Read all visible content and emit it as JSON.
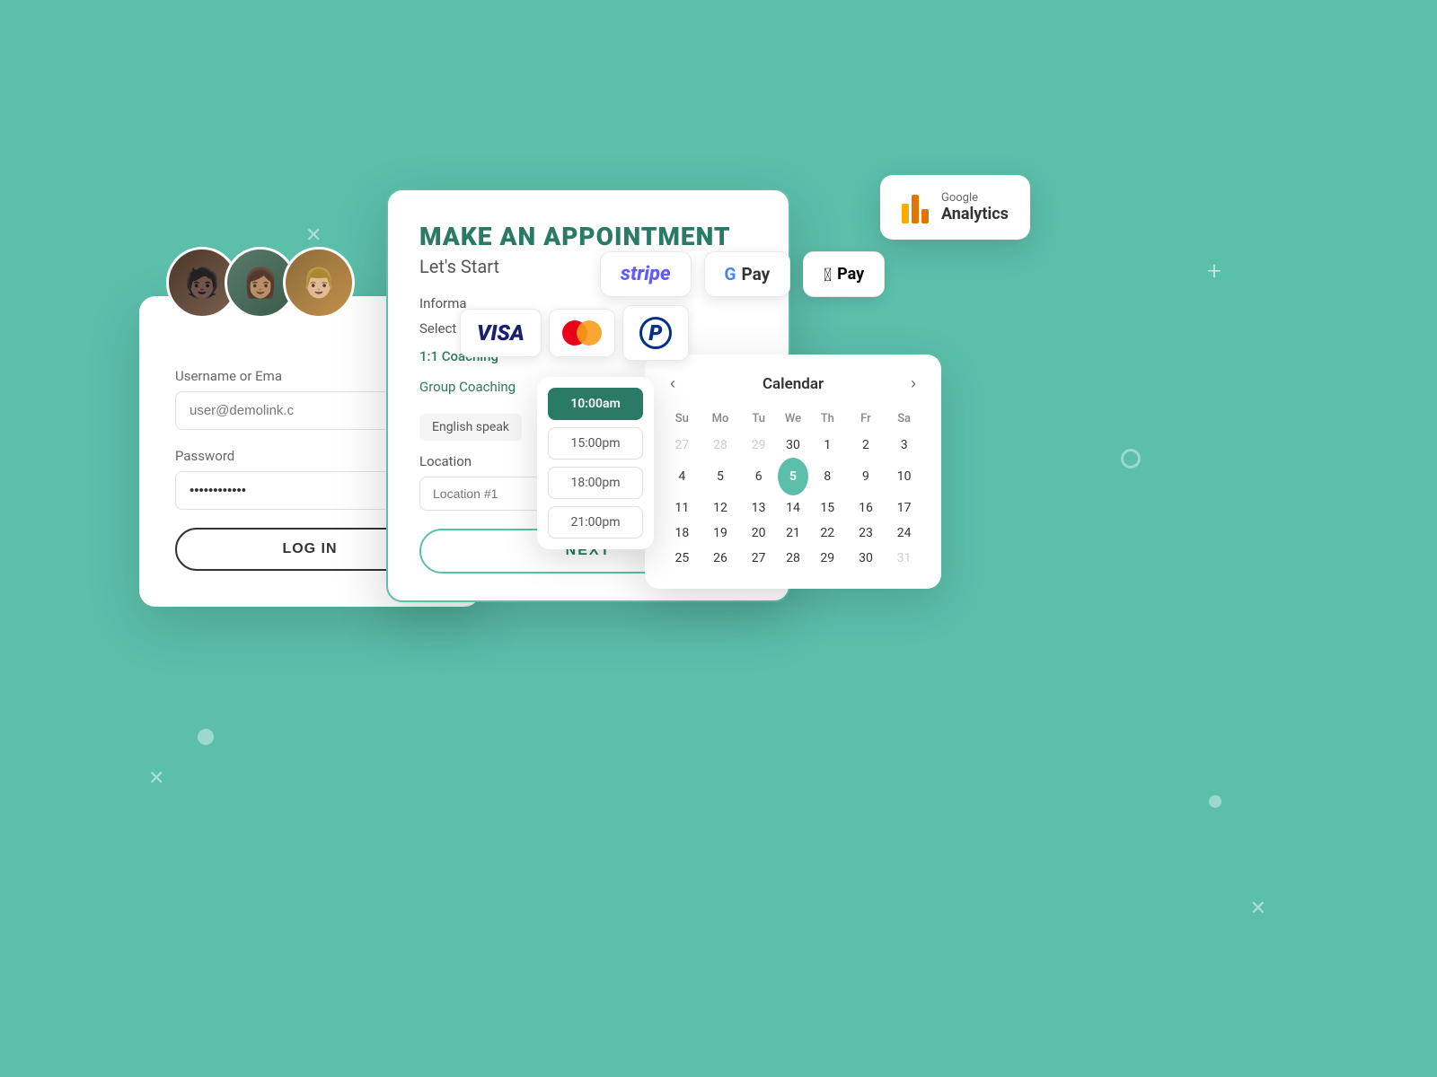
{
  "background": {
    "color": "#5bbfaa"
  },
  "decorations": {
    "plus_label": "+",
    "x_label": "×"
  },
  "login_card": {
    "username_label": "Username or Ema",
    "username_placeholder": "user@demolink.c",
    "password_label": "Password",
    "password_value": "············",
    "login_button": "LOG IN",
    "avatars": [
      "Person 1",
      "Person 2",
      "Person 3"
    ]
  },
  "appointment_card": {
    "title": "MAKE AN APPOINTMENT",
    "subtitle": "Let's Start",
    "info_section_label": "Informa",
    "select_service_label": "Select Service",
    "services": [
      {
        "name": "1:1 Coaching",
        "active": true
      },
      {
        "name": "Group Coaching",
        "active": false
      }
    ],
    "language_badge": "English speak",
    "location_label": "Location",
    "location_placeholder": "Location #1",
    "next_button": "NEXT"
  },
  "payment_logos": {
    "visa": "VISA",
    "mastercard": "MasterCard",
    "paypal": "P"
  },
  "floating_payments": [
    {
      "id": "stripe",
      "label": "stripe"
    },
    {
      "id": "gpay",
      "label": "G Pay"
    },
    {
      "id": "applepay",
      "label": " Pay"
    }
  ],
  "google_analytics": {
    "brand": "Google",
    "name": "Analytics"
  },
  "timeslots": [
    {
      "time": "10:00am",
      "active": true
    },
    {
      "time": "15:00pm",
      "active": false
    },
    {
      "time": "18:00pm",
      "active": false
    },
    {
      "time": "21:00pm",
      "active": false
    }
  ],
  "calendar": {
    "title": "Calendar",
    "prev": "‹",
    "next": "›",
    "weekdays": [
      "Su",
      "Mo",
      "Tu",
      "We",
      "Th",
      "Fr",
      "Sa"
    ],
    "weeks": [
      [
        {
          "day": "27",
          "type": "other"
        },
        {
          "day": "28",
          "type": "other"
        },
        {
          "day": "29",
          "type": "other"
        },
        {
          "day": "30",
          "type": "normal"
        },
        {
          "day": "1",
          "type": "normal"
        },
        {
          "day": "2",
          "type": "normal"
        },
        {
          "day": "3",
          "type": "normal"
        }
      ],
      [
        {
          "day": "4",
          "type": "normal"
        },
        {
          "day": "5",
          "type": "normal"
        },
        {
          "day": "6",
          "type": "normal"
        },
        {
          "day": "5",
          "type": "today"
        },
        {
          "day": "8",
          "type": "normal"
        },
        {
          "day": "9",
          "type": "normal"
        },
        {
          "day": "10",
          "type": "normal"
        }
      ],
      [
        {
          "day": "11",
          "type": "normal"
        },
        {
          "day": "12",
          "type": "normal"
        },
        {
          "day": "13",
          "type": "normal"
        },
        {
          "day": "14",
          "type": "normal"
        },
        {
          "day": "15",
          "type": "normal"
        },
        {
          "day": "16",
          "type": "normal"
        },
        {
          "day": "17",
          "type": "normal"
        }
      ],
      [
        {
          "day": "18",
          "type": "normal"
        },
        {
          "day": "19",
          "type": "normal"
        },
        {
          "day": "20",
          "type": "normal"
        },
        {
          "day": "21",
          "type": "normal"
        },
        {
          "day": "22",
          "type": "normal"
        },
        {
          "day": "23",
          "type": "normal"
        },
        {
          "day": "24",
          "type": "normal"
        }
      ],
      [
        {
          "day": "25",
          "type": "normal"
        },
        {
          "day": "26",
          "type": "normal"
        },
        {
          "day": "27",
          "type": "normal"
        },
        {
          "day": "28",
          "type": "normal"
        },
        {
          "day": "29",
          "type": "normal"
        },
        {
          "day": "30",
          "type": "normal"
        },
        {
          "day": "31",
          "type": "other"
        }
      ]
    ]
  }
}
